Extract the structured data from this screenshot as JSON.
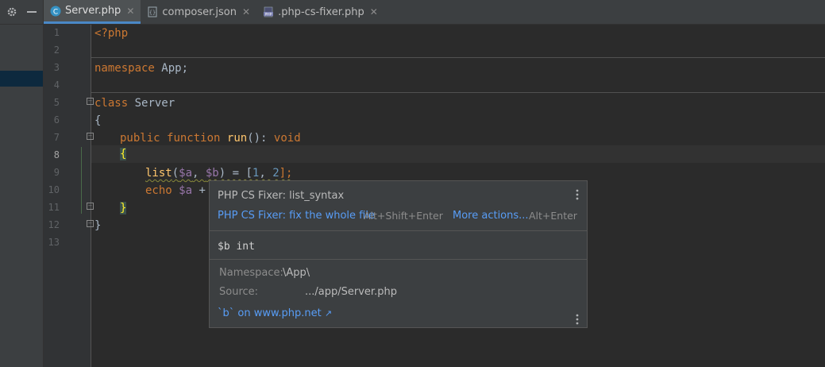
{
  "toolbar": {
    "settings_icon": "gear-icon",
    "minimize_icon": "minimize-icon"
  },
  "tabs": [
    {
      "label": "Server.php",
      "icon": "class-icon",
      "active": true
    },
    {
      "label": "composer.json",
      "icon": "json-file-icon",
      "active": false
    },
    {
      "label": ".php-cs-fixer.php",
      "icon": "php-file-icon",
      "active": false
    }
  ],
  "gutter": {
    "line_numbers": [
      "1",
      "2",
      "3",
      "4",
      "5",
      "6",
      "7",
      "8",
      "9",
      "10",
      "11",
      "12",
      "13"
    ],
    "current_line": "8"
  },
  "code": {
    "l1": "<?php",
    "l3_kw": "namespace",
    "l3_rest": " App;",
    "l5_kw": "class",
    "l5_rest": " Server",
    "l6": "{",
    "l7_kw1": "public",
    "l7_kw2": "function",
    "l7_fn": "run",
    "l7_paren": "(): ",
    "l7_type": "void",
    "l8": "{",
    "l9_fn": "list",
    "l9_p1": "(",
    "l9_v1": "$a",
    "l9_c": ", ",
    "l9_v2": "$b",
    "l9_eq": ") = [",
    "l9_n1": "1",
    "l9_c2": ", ",
    "l9_n2": "2",
    "l9_end": "];",
    "l10_kw": "echo",
    "l10_v": " $a",
    "l10_rest": " +",
    "l11": "}",
    "l12": "}"
  },
  "popup": {
    "inspection_title": "PHP CS Fixer: list_syntax",
    "fix_action": "PHP CS Fixer: fix the whole file",
    "fix_shortcut": "Alt+Shift+Enter",
    "more_actions": "More actions...",
    "more_shortcut": "Alt+Enter",
    "doc_signature": "$b int",
    "namespace_label": "Namespace:",
    "namespace_value": "\\App\\",
    "source_label": "Source:",
    "source_value": ".../app/Server.php",
    "external_link": "`b` on www.php.net",
    "external_link_icon": "external-link-icon",
    "menu_icon": "more-vertical-icon"
  },
  "colors": {
    "keyword": "#cc7832",
    "function": "#ffc66d",
    "variable": "#9876aa",
    "number": "#6897bb",
    "link": "#589df6",
    "accent": "#4a88c7"
  }
}
